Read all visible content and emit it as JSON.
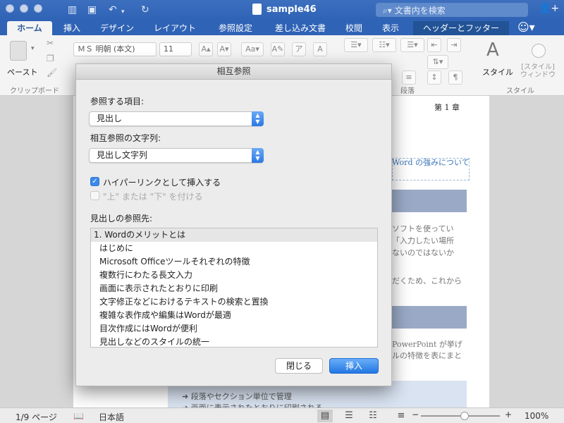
{
  "window": {
    "title": "sample46",
    "search_placeholder": "文書内を検索"
  },
  "tabs": [
    {
      "label": "ホーム"
    },
    {
      "label": "挿入"
    },
    {
      "label": "デザイン"
    },
    {
      "label": "レイアウト"
    },
    {
      "label": "参照設定"
    },
    {
      "label": "差し込み文書"
    },
    {
      "label": "校閲"
    },
    {
      "label": "表示"
    },
    {
      "label": "ヘッダーとフッター"
    }
  ],
  "ribbon": {
    "paste_label": "ペースト",
    "clipboard_group": "クリップボード",
    "font_name": "ＭＳ 明朝 (本文)",
    "font_size": "11",
    "paragraph_group": "段落",
    "styles_label": "スタイル",
    "styles_pane_label": "[スタイル]\nウィンドウ",
    "styles_group": "スタイル"
  },
  "document": {
    "header_text": "第 1 章",
    "box_text": "Word の強みについて",
    "lines1": [
      "ソフトを使ってい",
      "「入力したい場所",
      "ないのではないか"
    ],
    "line2": "だくため、これから",
    "lines3": [
      "PowerPoint が挙げ",
      "ルの特徴を表にまと"
    ],
    "bullets": [
      "段落やセクション単位で管理",
      "画面に表示されたとおりに印刷される"
    ]
  },
  "status": {
    "page": "1/9 ページ",
    "language": "日本語",
    "zoom": "100%",
    "zoom_level": 0.55
  },
  "dialog": {
    "title": "相互参照",
    "ref_type_label": "参照する項目:",
    "ref_type_value": "見出し",
    "insert_ref_label": "相互参照の文字列:",
    "insert_ref_value": "見出し文字列",
    "hyperlink_label": "ハイパーリンクとして挿入する",
    "hyperlink_checked": true,
    "above_below_label": "\"上\" または \"下\" を付ける",
    "above_below_checked": false,
    "for_which_label": "見出しの参照先:",
    "headings": [
      "1. Wordのメリットとは",
      "はじめに",
      "Microsoft Officeツールそれぞれの特徴",
      "複数行にわたる長文入力",
      "画面に表示されたとおりに印刷",
      "文字修正などにおけるテキストの検索と置換",
      "複雑な表作成や編集はWordが最適",
      "目次作成にはWordが便利",
      "見出しなどのスタイルの統一"
    ],
    "close_label": "閉じる",
    "insert_label": "挿入"
  }
}
